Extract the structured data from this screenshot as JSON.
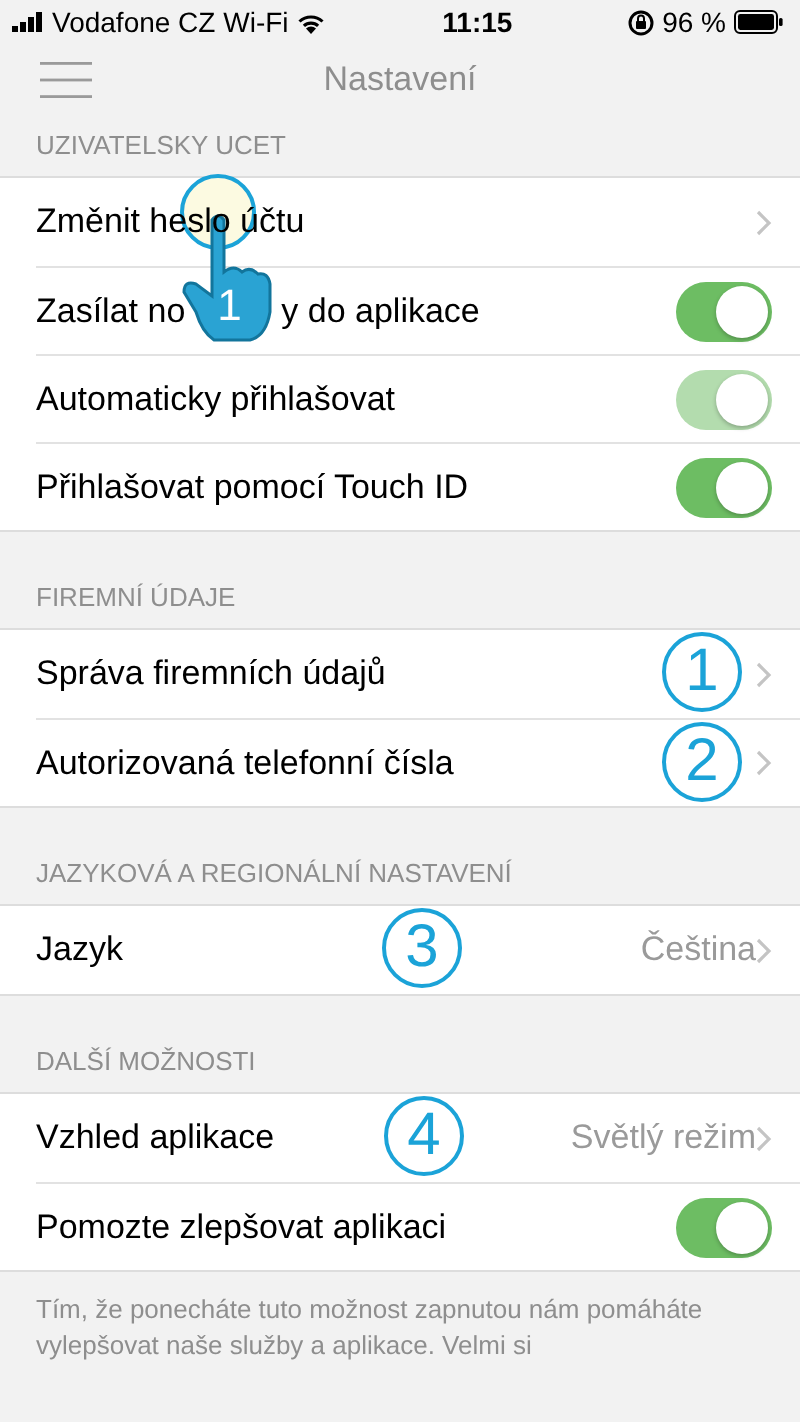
{
  "status_bar": {
    "carrier": "Vodafone CZ Wi-Fi",
    "time": "11:15",
    "battery": "96 %"
  },
  "nav_bar": {
    "title": "Nastavení"
  },
  "sections": [
    {
      "header": "UZIVATELSKY UCET",
      "rows": [
        {
          "kind": "link",
          "label": "Změnit heslo účtu",
          "callout": {
            "kind": "hand",
            "number": "1"
          }
        },
        {
          "kind": "toggle",
          "label_parts": [
            "Zasílat no",
            "y do aplikace"
          ],
          "on": true,
          "disabled": false
        },
        {
          "kind": "toggle",
          "label": "Automaticky přihlašovat",
          "on": true,
          "disabled": true
        },
        {
          "kind": "toggle",
          "label": "Přihlašovat pomocí Touch ID",
          "on": true,
          "disabled": false
        }
      ]
    },
    {
      "header": "FIREMNÍ ÚDAJE",
      "rows": [
        {
          "kind": "link",
          "label": "Správa firemních údajů",
          "callout": {
            "kind": "circle",
            "number": "1"
          }
        },
        {
          "kind": "link",
          "label": "Autorizovaná telefonní čísla",
          "callout": {
            "kind": "circle",
            "number": "2"
          }
        }
      ]
    },
    {
      "header": "JAZYKOVÁ A REGIONÁLNÍ NASTAVENÍ",
      "rows": [
        {
          "kind": "link",
          "label": "Jazyk",
          "value": "Čeština",
          "callout": {
            "kind": "circle",
            "number": "3"
          }
        }
      ]
    },
    {
      "header": "DALŠÍ MOŽNOSTI",
      "rows": [
        {
          "kind": "link",
          "label": "Vzhled aplikace",
          "value": "Světlý režim",
          "callout": {
            "kind": "circle",
            "number": "4"
          }
        },
        {
          "kind": "toggle",
          "label": "Pomozte zlepšovat aplikaci",
          "on": true,
          "disabled": false
        }
      ]
    }
  ],
  "footer_note": "Tím, že ponecháte tuto možnost zapnutou nám pomáháte vylepšovat naše služby a aplikace. Velmi si"
}
